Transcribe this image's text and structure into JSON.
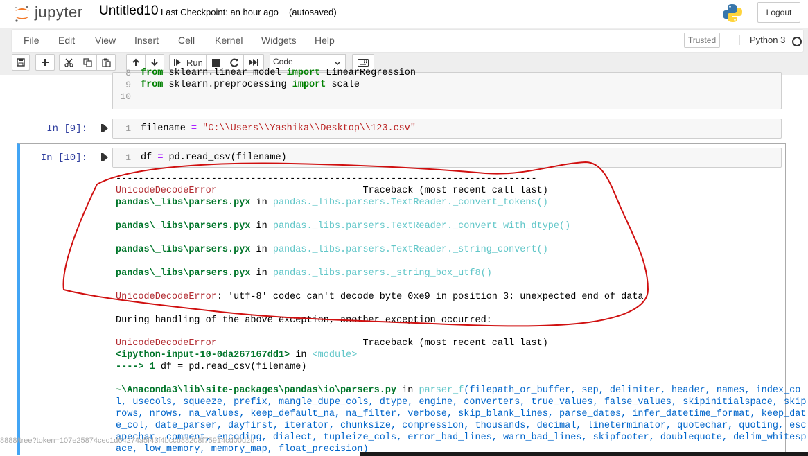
{
  "header": {
    "logo_text": "jupyter",
    "notebook_name": "Untitled10",
    "checkpoint": "Last Checkpoint: an hour ago",
    "autosave": "(autosaved)",
    "logout_label": "Logout"
  },
  "menu": {
    "items": [
      "File",
      "Edit",
      "View",
      "Insert",
      "Cell",
      "Kernel",
      "Widgets",
      "Help"
    ],
    "trusted_label": "Trusted",
    "kernel_name": "Python 3"
  },
  "toolbar": {
    "run_label": "Run",
    "cell_type": "Code",
    "icons": [
      "save-icon",
      "plus-icon",
      "cut-icon",
      "copy-icon",
      "paste-icon",
      "arrow-up-icon",
      "arrow-down-icon",
      "run-icon",
      "stop-icon",
      "restart-icon",
      "fast-forward-icon",
      "keyboard-icon"
    ]
  },
  "cells": {
    "first": {
      "line_numbers": [
        "8",
        "9",
        "10"
      ],
      "line8": {
        "kw1": "from",
        "mod": " sklearn.linear_model ",
        "kw2": "import",
        "name": " LinearRegression"
      },
      "line9": {
        "kw1": "from",
        "mod": " sklearn.preprocessing ",
        "kw2": "import",
        "name": " scale"
      }
    },
    "cell9": {
      "prompt": "In [9]:",
      "line_number": "1",
      "var": "filename ",
      "op": "=",
      "value": " \"C:\\\\Users\\\\Yashika\\\\Desktop\\\\123.csv\""
    },
    "cell10": {
      "prompt": "In [10]:",
      "line_number": "1",
      "var": "df ",
      "op": "=",
      "call": " pd.read_csv(filename)"
    }
  },
  "output": {
    "dashes": "---------------------------------------------------------------------------",
    "err1_name": "UnicodeDecodeError",
    "err1_tb": "                          Traceback (most recent call last)",
    "frames": [
      {
        "file": "pandas\\_libs\\parsers.pyx",
        "in": " in ",
        "func": "pandas._libs.parsers.TextReader._convert_tokens()"
      },
      {
        "file": "pandas\\_libs\\parsers.pyx",
        "in": " in ",
        "func": "pandas._libs.parsers.TextReader._convert_with_dtype()"
      },
      {
        "file": "pandas\\_libs\\parsers.pyx",
        "in": " in ",
        "func": "pandas._libs.parsers.TextReader._string_convert()"
      },
      {
        "file": "pandas\\_libs\\parsers.pyx",
        "in": " in ",
        "func": "pandas._libs.parsers._string_box_utf8()"
      }
    ],
    "err_msg_name": "UnicodeDecodeError",
    "err_msg_text": ": 'utf-8' codec can't decode byte 0xe9 in position 3: unexpected end of data",
    "during": "During handling of the above exception, another exception occurred:",
    "err2_name": "UnicodeDecodeError",
    "err2_tb": "                          Traceback (most recent call last)",
    "ipy_input": "<ipython-input-10-0da267167dd1>",
    "ipy_in": " in ",
    "ipy_module": "<module>",
    "arrow": "----> 1 ",
    "arrow_code": "df = pd.read_csv(filename)",
    "parsers_file": "~\\Anaconda3\\lib\\site-packages\\pandas\\io\\parsers.py",
    "parsers_in": " in ",
    "parser_func": "parser_f",
    "sig_lines": [
      "(filepath_or_buffer, sep, delimiter, header, names, index_co",
      "l, usecols, squeeze, prefix, mangle_dupe_cols, dtype, engine, converters, true_values, false_values, skipinitialspace, skip",
      "rows, nrows, na_values, keep_default_na, na_filter, verbose, skip_blank_lines, parse_dates, infer_datetime_format, keep_dat",
      "e_col, date_parser, dayfirst, iterator, chunksize, compression, thousands, decimal, lineterminator, quotechar, quoting, esc",
      "apechar, comment, encoding, dialect, tupleize_cols, error_bad_lines, warn_bad_lines, skipfooter, doublequote, delim_whitesp",
      "ace, low_memory, memory_map, float_precision)"
    ]
  },
  "status_url": "8888/tree?token=107e25874cec1d64274a5f43f4bccb88208f75914cd00d2d",
  "colors": {
    "accent_blue": "#42a5f5",
    "prompt_blue": "#303f9f",
    "error_red": "#b22b31",
    "green": "#00752a",
    "cyan": "#60c6c8",
    "annotation_red": "#d01010"
  }
}
